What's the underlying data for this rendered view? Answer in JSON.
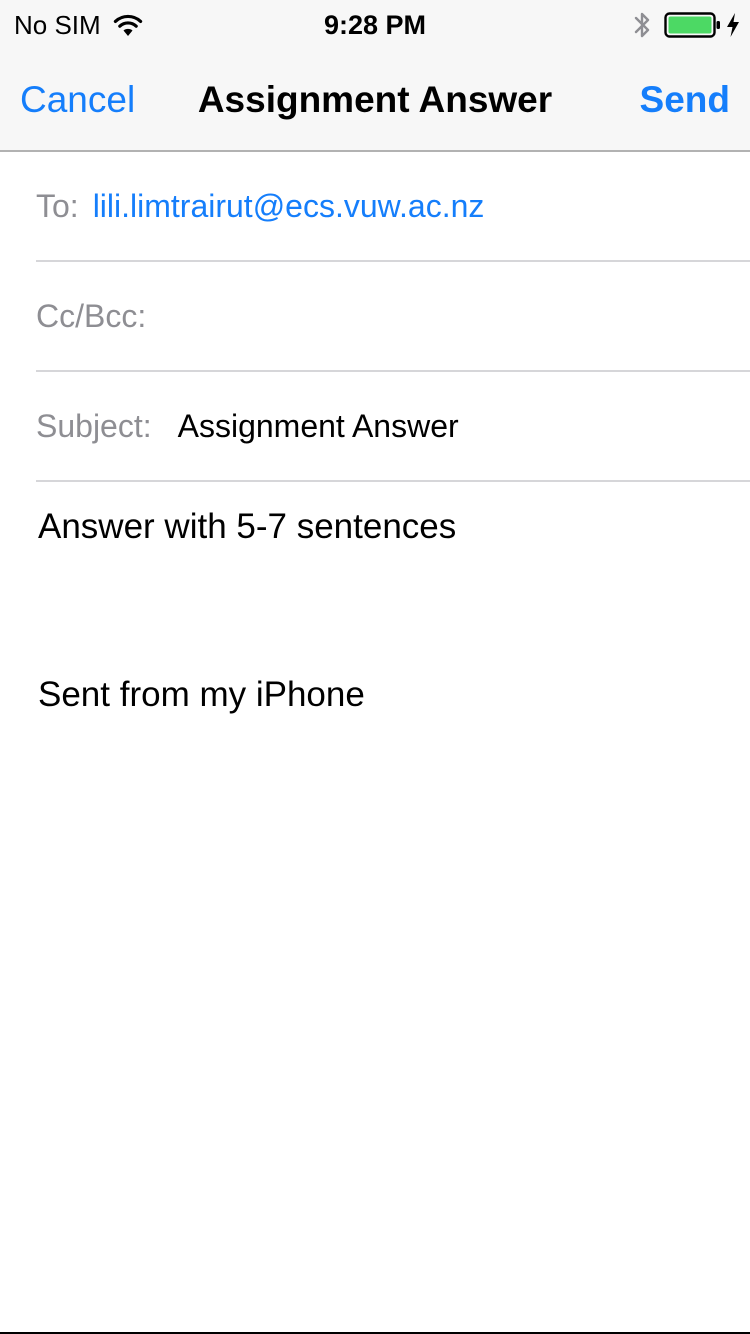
{
  "status_bar": {
    "carrier": "No SIM",
    "time": "9:28 PM",
    "icons": [
      "wifi-icon",
      "bluetooth-icon",
      "battery-icon",
      "charging-bolt-icon"
    ]
  },
  "nav": {
    "cancel_label": "Cancel",
    "title": "Assignment Answer",
    "send_label": "Send"
  },
  "fields": {
    "to_label": "To:",
    "to_value": "lili.limtrairut@ecs.vuw.ac.nz",
    "cc_label": "Cc/Bcc:",
    "subject_label": "Subject:",
    "subject_value": "Assignment Answer"
  },
  "body": {
    "text": "Answer with 5-7 sentences",
    "signature": "Sent from my iPhone"
  },
  "colors": {
    "accent": "#157efb",
    "label_gray": "#8e8e93",
    "battery_green": "#4cd964",
    "nav_background": "#f7f7f7"
  }
}
